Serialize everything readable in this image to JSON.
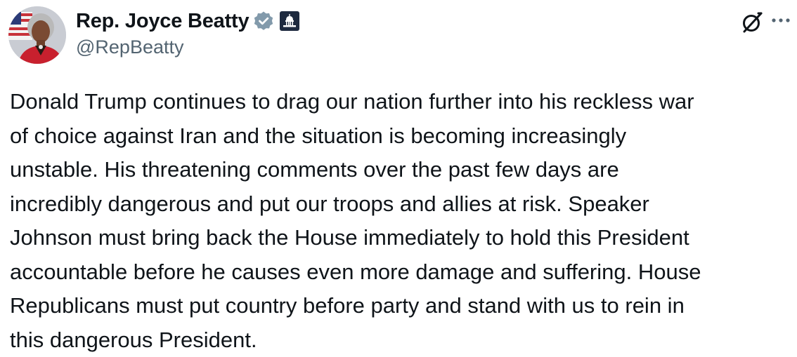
{
  "author": {
    "display_name": "Rep. Joyce Beatty",
    "handle": "@RepBeatty",
    "verified_icon": "verified-check-icon",
    "affiliation_icon": "capitol-building-icon"
  },
  "actions": {
    "grok_icon": "grok-icon",
    "more_icon": "more-options-icon"
  },
  "post": {
    "text": "Donald Trump continues to drag our nation further into his reckless war\nof choice against Iran and the situation is becoming increasingly\nunstable. His threatening comments over the past few days are\nincredibly dangerous and put our troops and allies at risk.  Speaker\nJohnson must bring back the House immediately to hold this President\naccountable before he causes even more damage and suffering. House\nRepublicans must put country before party and stand with us to rein in\nthis dangerous President."
  },
  "colors": {
    "text": "#0f1419",
    "secondary_text": "#536471",
    "verified_badge": "#829aab",
    "background": "#ffffff"
  }
}
